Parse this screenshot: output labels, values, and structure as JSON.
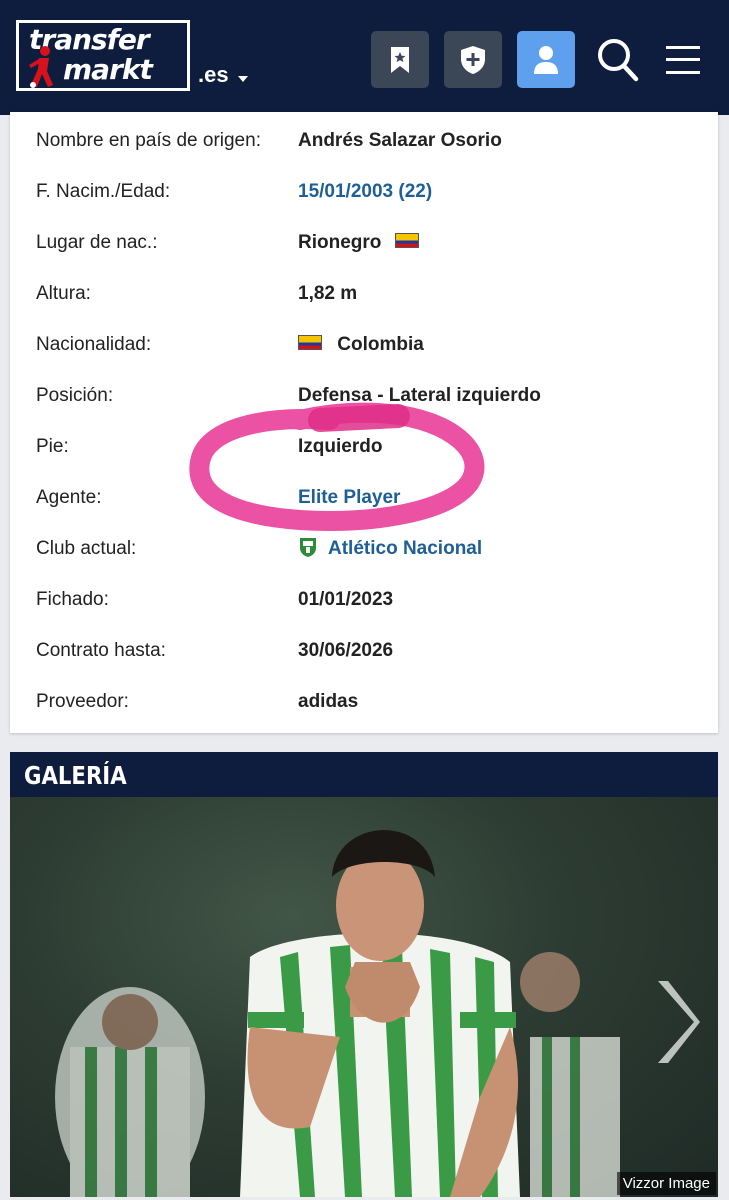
{
  "header": {
    "logo_line1": "transfer",
    "logo_line2": "markt",
    "tld": ".es",
    "buttons": [
      {
        "name": "bookmark-button",
        "icon": "bookmark-star-icon"
      },
      {
        "name": "club-shield-button",
        "icon": "shield-plus-icon"
      },
      {
        "name": "profile-button",
        "icon": "user-icon"
      }
    ],
    "colors": {
      "bg": "#0e1d3e",
      "button": "#3b4657",
      "active_button": "#5fa0ee"
    }
  },
  "profile": {
    "rows": [
      {
        "label": "Nombre en país de origen:",
        "value": "Andrés Salazar Osorio"
      },
      {
        "label": "F. Nacim./Edad:",
        "value": "15/01/2003 (22)"
      },
      {
        "label": "Lugar de nac.:",
        "value": "Rionegro"
      },
      {
        "label": "Altura:",
        "value": "1,82 m"
      },
      {
        "label": "Nacionalidad:",
        "value": "Colombia"
      },
      {
        "label": "Posición:",
        "value": "Defensa - Lateral izquierdo"
      },
      {
        "label": "Pie:",
        "value": "Izquierdo"
      },
      {
        "label": "Agente:",
        "value": "Elite Player"
      },
      {
        "label": "Club actual:",
        "value": "Atlético Nacional"
      },
      {
        "label": "Fichado:",
        "value": "01/01/2023"
      },
      {
        "label": "Contrato hasta:",
        "value": "30/06/2026"
      },
      {
        "label": "Proveedor:",
        "value": "adidas"
      }
    ],
    "link_color": "#1d5f96",
    "highlight_color": "#ea3f9a"
  },
  "gallery": {
    "title": "GALERÍA",
    "credit": "Vizzor Image"
  }
}
